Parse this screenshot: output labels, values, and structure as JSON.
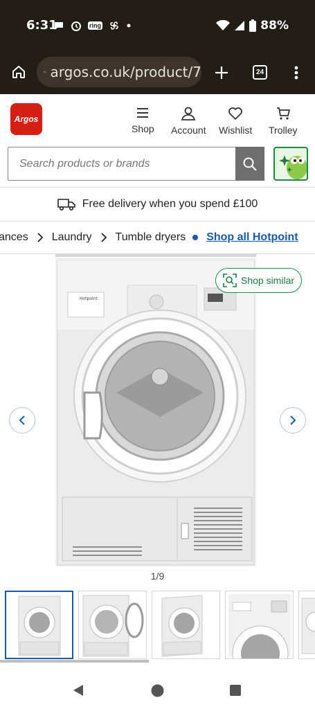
{
  "status_bar": {
    "time": "6:31",
    "ring_label": "ring",
    "battery": "88%"
  },
  "browser": {
    "url": "argos.co.uk/product/7",
    "tab_count": "24"
  },
  "header": {
    "logo": "Argos",
    "nav": [
      {
        "label": "Shop",
        "icon": "menu-icon"
      },
      {
        "label": "Account",
        "icon": "person-icon"
      },
      {
        "label": "Wishlist",
        "icon": "heart-icon"
      },
      {
        "label": "Trolley",
        "icon": "trolley-icon"
      }
    ]
  },
  "search": {
    "placeholder": "Search products or brands"
  },
  "delivery": {
    "text": "Free delivery when you spend £100"
  },
  "breadcrumb": {
    "items": [
      "ances",
      "Laundry",
      "Tumble dryers"
    ],
    "link": "Shop all Hotpoint"
  },
  "product": {
    "brand_on_image": "Hotpoint",
    "shop_similar_label": "Shop similar",
    "image_counter": "1/9",
    "thumbnail_count": 5
  },
  "colors": {
    "brand_red": "#d42114",
    "link_blue": "#1b5aa8",
    "green": "#1e8a4a",
    "dark_bar": "#231d17"
  }
}
